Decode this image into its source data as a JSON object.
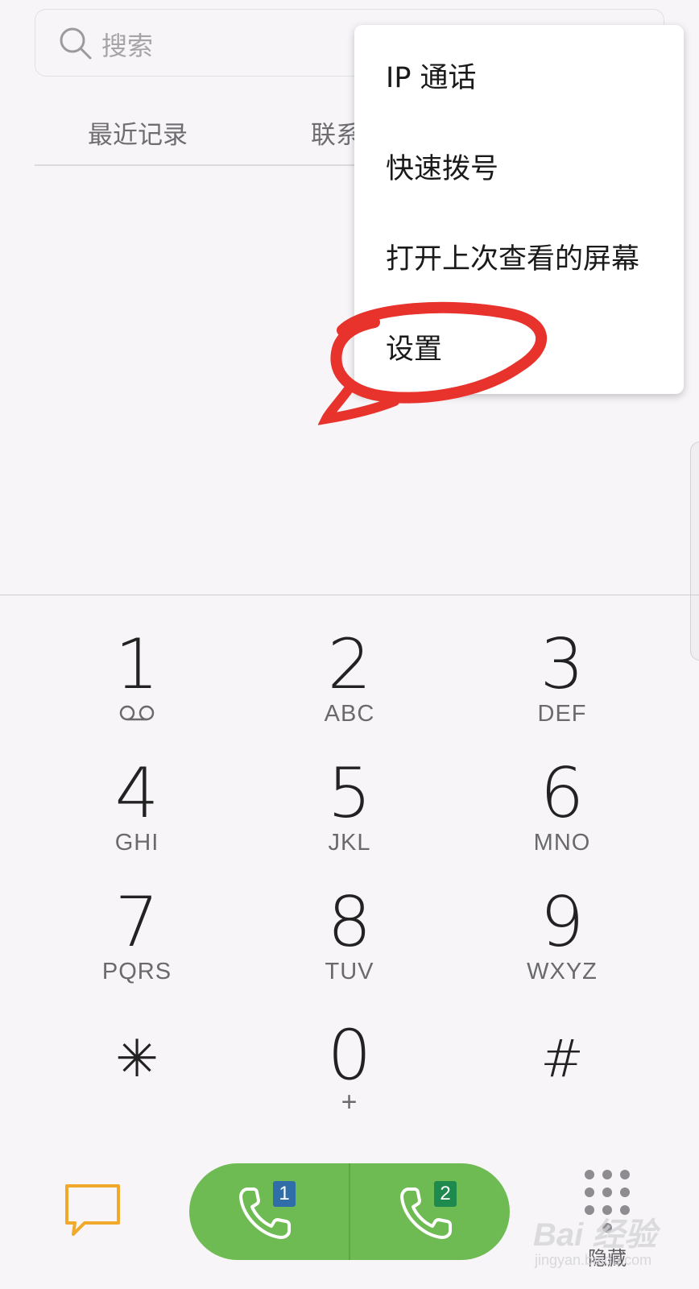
{
  "search": {
    "placeholder": "搜索"
  },
  "tabs": [
    {
      "label": "最近记录"
    },
    {
      "label": "联系"
    }
  ],
  "overflow_menu": {
    "items": [
      {
        "label": "IP 通话"
      },
      {
        "label": "快速拨号"
      },
      {
        "label": "打开上次查看的屏幕"
      },
      {
        "label": "设置"
      }
    ]
  },
  "annotation": {
    "color": "#e8332d"
  },
  "keypad": [
    {
      "digit": "1",
      "letters": ""
    },
    {
      "digit": "2",
      "letters": "ABC"
    },
    {
      "digit": "3",
      "letters": "DEF"
    },
    {
      "digit": "4",
      "letters": "GHI"
    },
    {
      "digit": "5",
      "letters": "JKL"
    },
    {
      "digit": "6",
      "letters": "MNO"
    },
    {
      "digit": "7",
      "letters": "PQRS"
    },
    {
      "digit": "8",
      "letters": "TUV"
    },
    {
      "digit": "9",
      "letters": "WXYZ"
    },
    {
      "digit": "✳",
      "letters": ""
    },
    {
      "digit": "0",
      "letters": "+"
    },
    {
      "digit": "#",
      "letters": ""
    }
  ],
  "bottom_bar": {
    "sim1_label": "1",
    "sim2_label": "2",
    "hide_label": "隐藏",
    "call_color": "#6fbb53",
    "message_icon_color": "#f0a92a"
  },
  "watermark": {
    "text": "Bai 经验",
    "url": "jingyan.baidu.com"
  }
}
